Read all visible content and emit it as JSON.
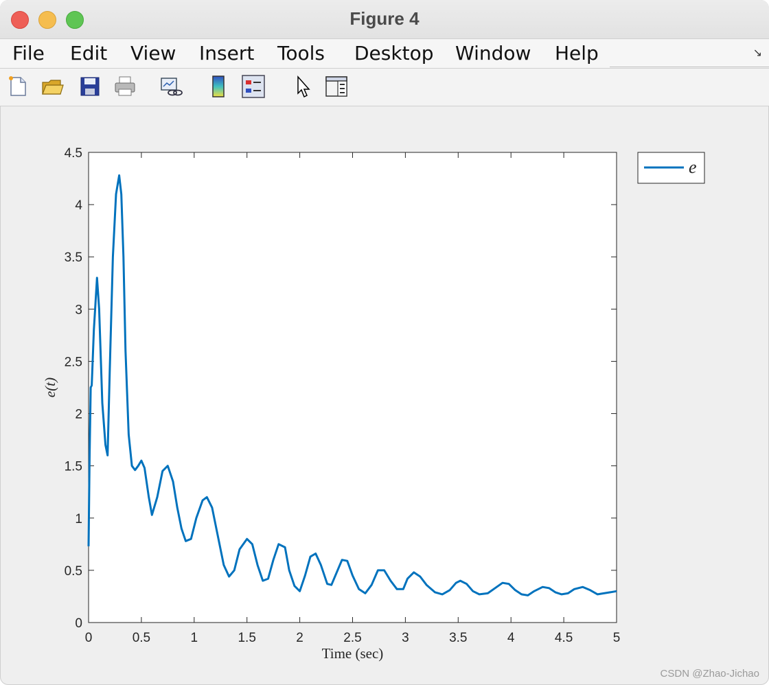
{
  "window": {
    "title": "Figure 4"
  },
  "menu": {
    "items": [
      "File",
      "Edit",
      "View",
      "Insert",
      "Tools",
      "Desktop",
      "Window",
      "Help"
    ]
  },
  "toolbar": {
    "icons": [
      "new-figure-icon",
      "open-file-icon",
      "save-icon",
      "print-icon",
      "link-plot-icon",
      "insert-colorbar-icon",
      "insert-legend-icon",
      "edit-plot-icon",
      "property-inspector-icon"
    ]
  },
  "watermark": "CSDN @Zhao-Jichao",
  "chart_data": {
    "type": "line",
    "xlabel": "Time (sec)",
    "ylabel": "e(t)",
    "xlim": [
      0,
      5
    ],
    "ylim": [
      0,
      4.5
    ],
    "xticks": [
      "0",
      "0.5",
      "1",
      "1.5",
      "2",
      "2.5",
      "3",
      "3.5",
      "4",
      "4.5",
      "5"
    ],
    "yticks": [
      "0",
      "0.5",
      "1",
      "1.5",
      "2",
      "2.5",
      "3",
      "3.5",
      "4",
      "4.5"
    ],
    "grid": false,
    "legend_position": "outside-top-right",
    "series": [
      {
        "name": "e",
        "color": "#0072bd",
        "x": [
          0,
          0.01,
          0.02,
          0.03,
          0.05,
          0.08,
          0.1,
          0.13,
          0.16,
          0.18,
          0.2,
          0.23,
          0.26,
          0.29,
          0.31,
          0.33,
          0.35,
          0.38,
          0.41,
          0.44,
          0.47,
          0.5,
          0.53,
          0.57,
          0.6,
          0.65,
          0.7,
          0.75,
          0.8,
          0.84,
          0.88,
          0.92,
          0.97,
          1.02,
          1.08,
          1.12,
          1.17,
          1.22,
          1.28,
          1.33,
          1.38,
          1.43,
          1.5,
          1.55,
          1.6,
          1.65,
          1.7,
          1.75,
          1.8,
          1.86,
          1.9,
          1.95,
          2.0,
          2.05,
          2.1,
          2.15,
          2.2,
          2.26,
          2.3,
          2.35,
          2.4,
          2.45,
          2.5,
          2.56,
          2.62,
          2.68,
          2.74,
          2.8,
          2.86,
          2.92,
          2.98,
          3.02,
          3.08,
          3.14,
          3.2,
          3.28,
          3.35,
          3.42,
          3.48,
          3.52,
          3.58,
          3.64,
          3.7,
          3.78,
          3.85,
          3.92,
          3.98,
          4.04,
          4.1,
          4.16,
          4.22,
          4.3,
          4.36,
          4.42,
          4.48,
          4.54,
          4.6,
          4.68,
          4.75,
          4.82,
          4.88,
          4.94,
          5.0
        ],
        "y": [
          0.73,
          1.6,
          2.25,
          2.27,
          2.8,
          3.3,
          3.0,
          2.1,
          1.7,
          1.6,
          2.4,
          3.5,
          4.1,
          4.28,
          4.1,
          3.5,
          2.6,
          1.8,
          1.5,
          1.46,
          1.5,
          1.55,
          1.48,
          1.2,
          1.03,
          1.2,
          1.45,
          1.5,
          1.35,
          1.1,
          0.9,
          0.78,
          0.8,
          1.0,
          1.17,
          1.2,
          1.1,
          0.85,
          0.55,
          0.44,
          0.5,
          0.7,
          0.8,
          0.75,
          0.55,
          0.4,
          0.42,
          0.6,
          0.75,
          0.72,
          0.5,
          0.35,
          0.3,
          0.45,
          0.63,
          0.66,
          0.55,
          0.37,
          0.36,
          0.48,
          0.6,
          0.59,
          0.45,
          0.32,
          0.28,
          0.36,
          0.5,
          0.5,
          0.4,
          0.32,
          0.32,
          0.42,
          0.48,
          0.44,
          0.36,
          0.29,
          0.27,
          0.31,
          0.38,
          0.4,
          0.37,
          0.3,
          0.27,
          0.28,
          0.33,
          0.38,
          0.37,
          0.31,
          0.27,
          0.26,
          0.3,
          0.34,
          0.33,
          0.29,
          0.27,
          0.28,
          0.32,
          0.34,
          0.31,
          0.27,
          0.28,
          0.29,
          0.3
        ]
      }
    ]
  }
}
